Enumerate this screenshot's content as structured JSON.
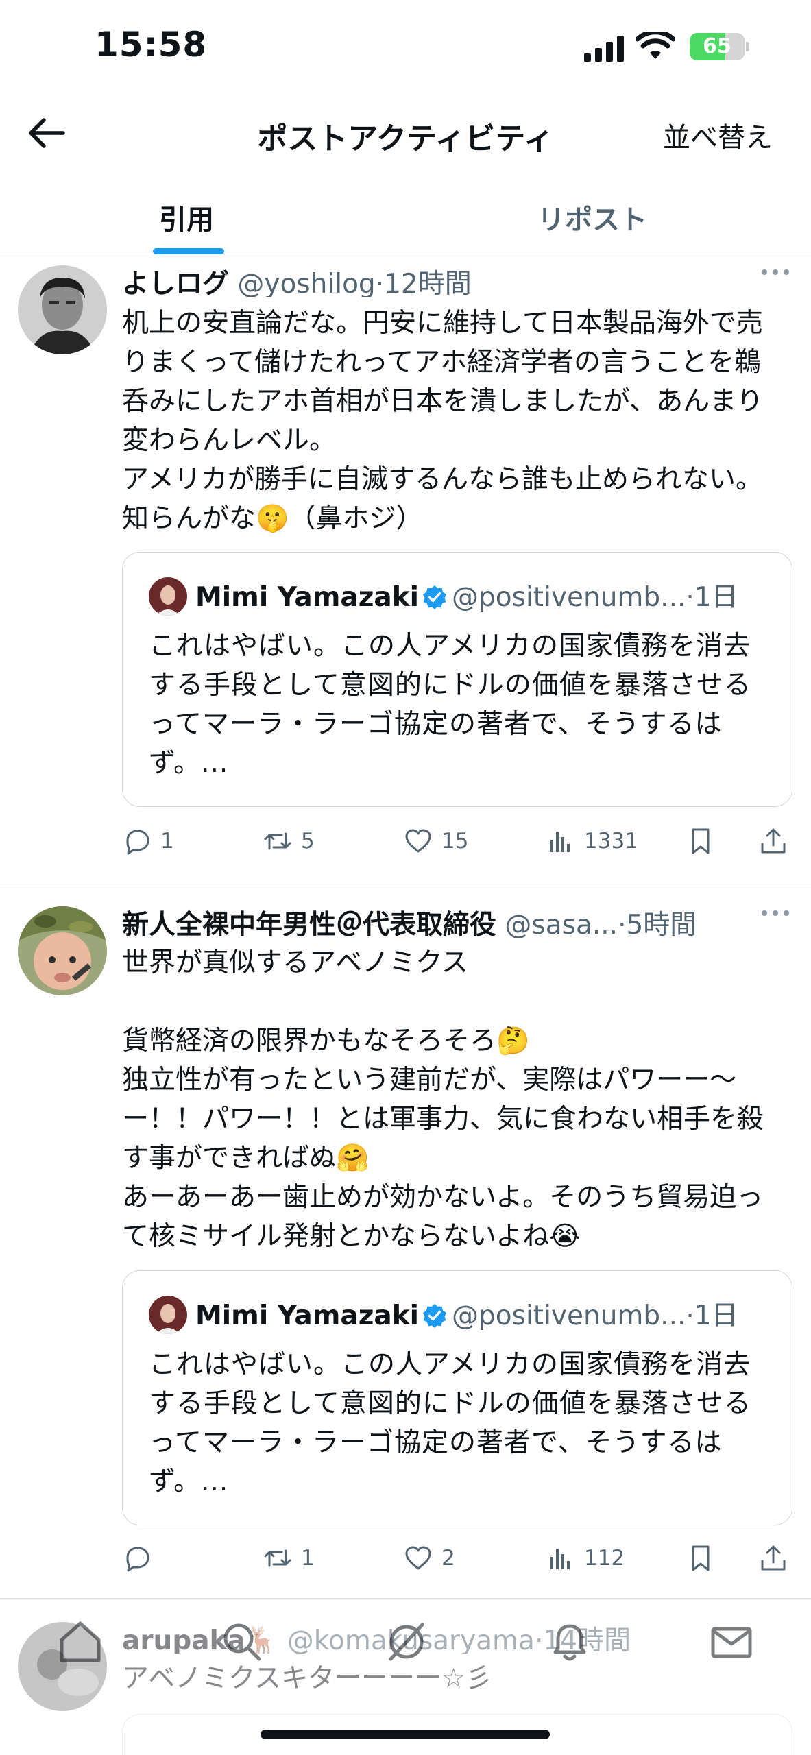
{
  "status_bar": {
    "time": "15:58",
    "battery": "65",
    "battery_level": 0.65
  },
  "header": {
    "title": "ポストアクティビティ",
    "sort_label": "並べ替え"
  },
  "tabs": [
    {
      "label": "引用"
    },
    {
      "label": "リポスト"
    }
  ],
  "posts": [
    {
      "author": "よしログ",
      "handle": "@yoshilog",
      "time": "12時間",
      "text": "机上の安直論だな。円安に維持して日本製品海外で売りまくって儲けたれってアホ経済学者の言うことを鵜呑みにしたアホ首相が日本を潰しましたが、あんまり変わらんレベル。\nアメリカが勝手に自滅するんなら誰も止められない。知らんがな🤫（鼻ホジ）",
      "quote": {
        "author": "Mimi Yamazaki",
        "handle": "@positivenumb...",
        "time": "1日",
        "text": "これはやばい。この人アメリカの国家債務を消去する手段として意図的にドルの価値を暴落させるってマーラ・ラーゴ協定の著者で、そうするはず。..."
      },
      "stats": {
        "replies": "1",
        "reposts": "5",
        "likes": "15",
        "views": "1331"
      }
    },
    {
      "author": "新人全裸中年男性＠代表取締役",
      "handle": "@sasa...",
      "time": "5時間",
      "text": "世界が真似するアベノミクス\n\n貨幣経済の限界かもなそろそろ🤔\n独立性が有ったという建前だが、実際はパワーー〜ー！！パワー！！とは軍事力、気に食わない相手を殺す事ができればぬ🤗\nあーあーあー歯止めが効かないよ。そのうち貿易迫って核ミサイル発射とかならないよね😭",
      "quote": {
        "author": "Mimi Yamazaki",
        "handle": "@positivenumb...",
        "time": "1日",
        "text": "これはやばい。この人アメリカの国家債務を消去する手段として意図的にドルの価値を暴落させるってマーラ・ラーゴ協定の著者で、そうするはず。..."
      },
      "stats": {
        "replies": "",
        "reposts": "1",
        "likes": "2",
        "views": "112"
      }
    },
    {
      "author": "arupaka",
      "author_emoji": "🦌",
      "handle": "@komakusaryama",
      "time": "14時間",
      "text": "アベノミクスキターーーー☆彡"
    }
  ]
}
